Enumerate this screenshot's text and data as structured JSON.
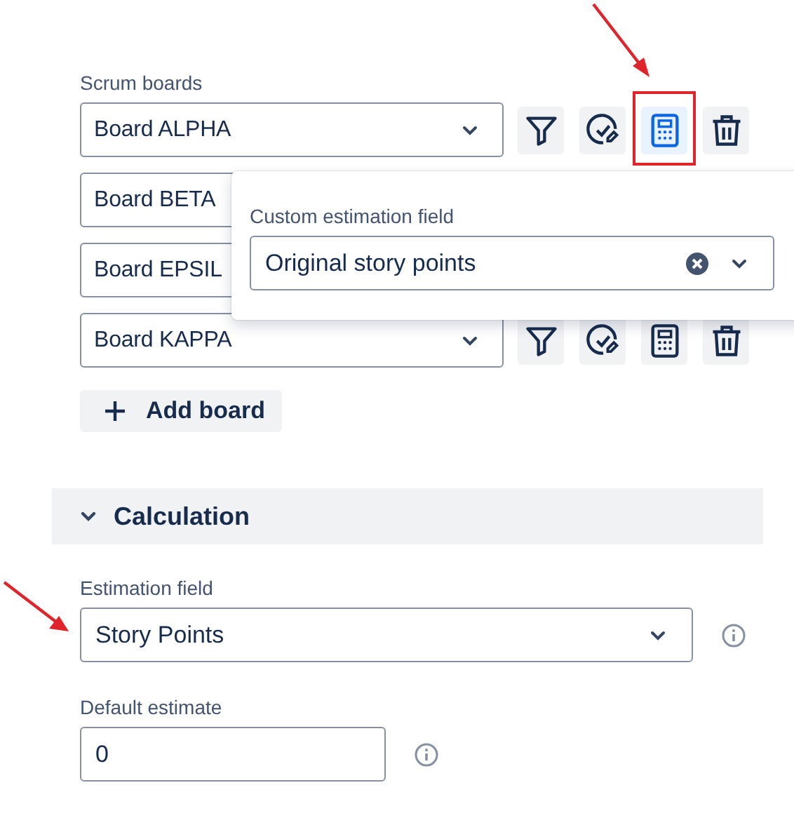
{
  "scrum_boards": {
    "label": "Scrum boards",
    "boards": [
      {
        "name": "Board ALPHA",
        "actions": [
          {
            "kind": "filter",
            "selected": false
          },
          {
            "kind": "estimate",
            "selected": false
          },
          {
            "kind": "calculator",
            "selected": true,
            "annotated": true
          },
          {
            "kind": "delete",
            "selected": false
          }
        ]
      },
      {
        "name": "Board BETA"
      },
      {
        "name": "Board EPSIL"
      },
      {
        "name": "Board KAPPA",
        "actions": [
          {
            "kind": "filter",
            "selected": false
          },
          {
            "kind": "estimate",
            "selected": false
          },
          {
            "kind": "calculator",
            "selected": false
          },
          {
            "kind": "delete",
            "selected": false
          }
        ]
      }
    ],
    "add_button": "Add board"
  },
  "popup": {
    "label": "Custom estimation field",
    "value": "Original story points"
  },
  "calculation": {
    "title": "Calculation",
    "expanded": true,
    "estimation_field": {
      "label": "Estimation field",
      "value": "Story Points",
      "annotated": true
    },
    "default_estimate": {
      "label": "Default estimate",
      "value": "0"
    }
  }
}
